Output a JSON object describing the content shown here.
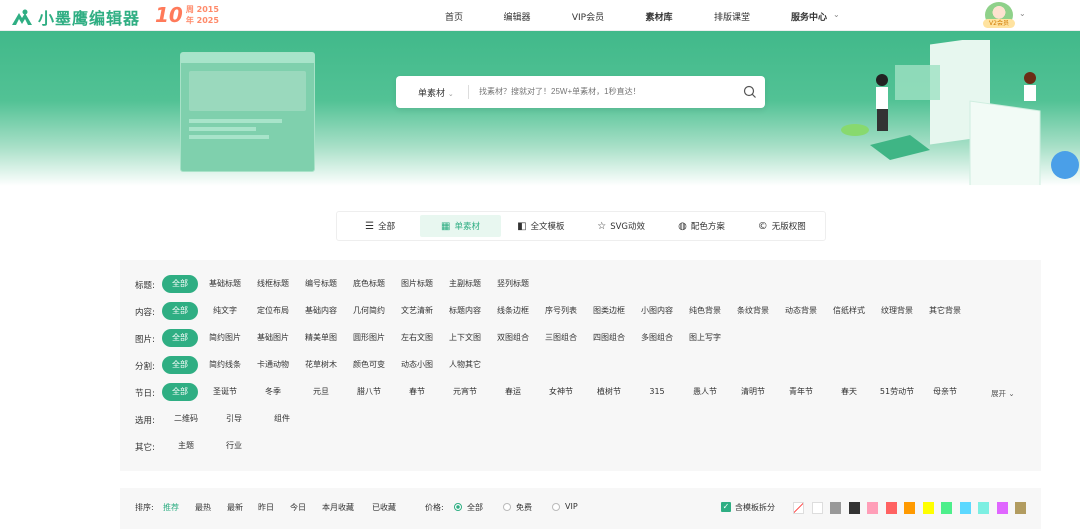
{
  "header": {
    "logo_text": "小墨鹰编辑器",
    "anniversary_big": "10",
    "anniversary_char1": "周",
    "anniversary_char2": "年",
    "year_start": "2015",
    "year_end": "2025",
    "nav": [
      {
        "label": "首页"
      },
      {
        "label": "编辑器"
      },
      {
        "label": "VIP会员"
      },
      {
        "label": "素材库"
      },
      {
        "label": "排版课堂"
      },
      {
        "label": "服务中心"
      }
    ],
    "badge": "V2会员"
  },
  "search": {
    "type": "单素材",
    "placeholder": "找素材？搜就对了！25W+单素材，1秒直达！"
  },
  "tabs": [
    {
      "label": "全部",
      "icon": "list-icon"
    },
    {
      "label": "单素材",
      "icon": "grid-icon"
    },
    {
      "label": "全文模板",
      "icon": "template-icon"
    },
    {
      "label": "SVG动效",
      "icon": "star-icon"
    },
    {
      "label": "配色方案",
      "icon": "palette-icon"
    },
    {
      "label": "无版权图",
      "icon": "copyright-icon"
    }
  ],
  "filters": [
    {
      "label": "标题:",
      "items": [
        "全部",
        "基础标题",
        "线框标题",
        "编号标题",
        "底色标题",
        "图片标题",
        "主副标题",
        "竖列标题"
      ]
    },
    {
      "label": "内容:",
      "items": [
        "全部",
        "纯文字",
        "定位布局",
        "基础内容",
        "几何简约",
        "文艺清新",
        "标题内容",
        "线条边框",
        "序号列表",
        "图类边框",
        "小图内容",
        "纯色背景",
        "条纹背景",
        "动态背景",
        "信纸样式",
        "纹理背景",
        "其它背景"
      ]
    },
    {
      "label": "图片:",
      "items": [
        "全部",
        "简约图片",
        "基础图片",
        "精美单图",
        "圆形图片",
        "左右文图",
        "上下文图",
        "双图组合",
        "三图组合",
        "四图组合",
        "多图组合",
        "图上写字"
      ]
    },
    {
      "label": "分割:",
      "items": [
        "全部",
        "简约线条",
        "卡通动物",
        "花草树木",
        "颜色可变",
        "动态小图",
        "人物其它"
      ]
    },
    {
      "label": "节日:",
      "items": [
        "全部",
        "圣诞节",
        "冬季",
        "元旦",
        "腊八节",
        "春节",
        "元宵节",
        "春运",
        "女神节",
        "植树节",
        "315",
        "愚人节",
        "清明节",
        "青年节",
        "春天",
        "51劳动节",
        "母亲节"
      ]
    },
    {
      "label": "选用:",
      "items": [
        "二维码",
        "引导",
        "组件"
      ]
    },
    {
      "label": "其它:",
      "items": [
        "主题",
        "行业"
      ]
    }
  ],
  "expand_label": "展开",
  "sort": {
    "label": "排序:",
    "options": [
      "推荐",
      "最热",
      "最新",
      "昨日",
      "今日",
      "本月收藏",
      "已收藏"
    ],
    "active": "推荐"
  },
  "price": {
    "label": "价格:",
    "options": [
      "全部",
      "免费",
      "VIP"
    ],
    "selected": "全部"
  },
  "split_label": "含模板拆分",
  "colors": [
    "none",
    "#ffffff",
    "#999999",
    "#333333",
    "#ff9eb8",
    "#ff6262",
    "#ff9a00",
    "#ffff00",
    "#4def8b",
    "#5cd8ff",
    "#7cefe2",
    "#e066ff",
    "#b29c60"
  ]
}
